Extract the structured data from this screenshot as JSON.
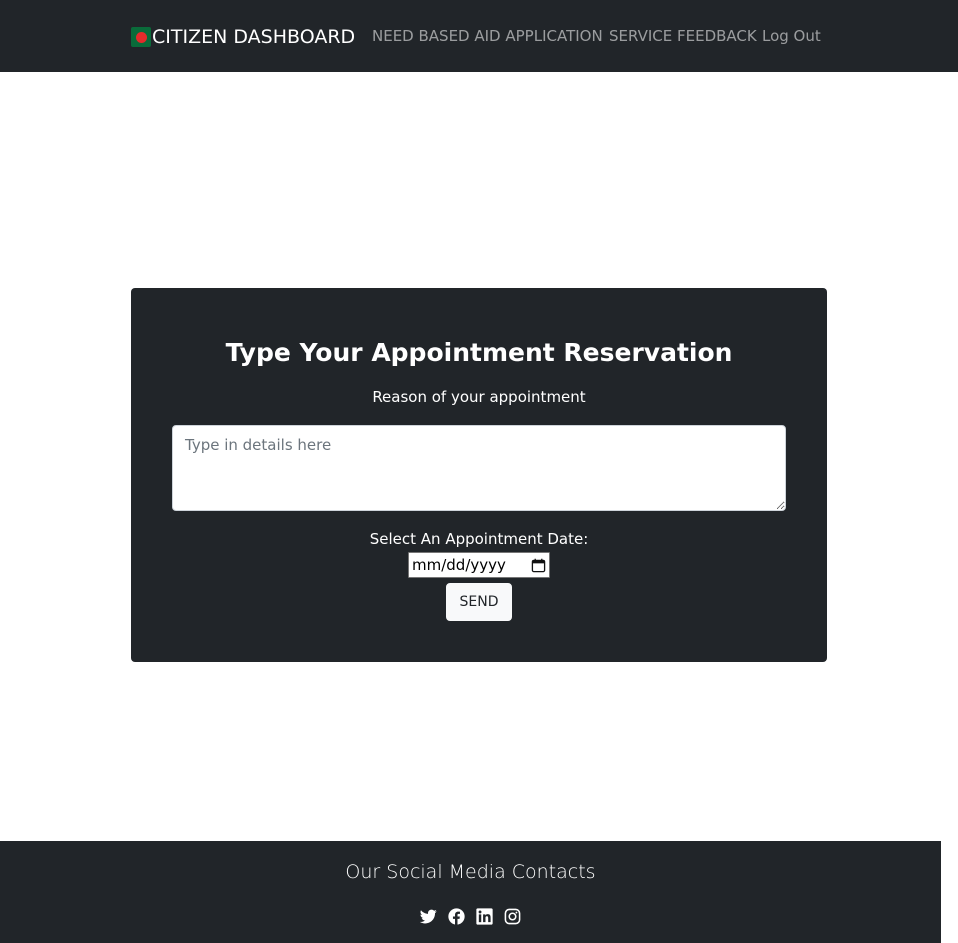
{
  "navbar": {
    "brand_label": "CITIZEN DASHBOARD",
    "brand_icon": "government-logo-icon",
    "links": [
      {
        "label": "NEED BASED AID APPLICATION"
      },
      {
        "label": "SERVICE FEEDBACK"
      },
      {
        "label": "Log Out"
      }
    ]
  },
  "form": {
    "title": "Type Your Appointment Reservation",
    "reason_label": "Reason of your appointment",
    "details_placeholder": "Type in details here",
    "details_value": "",
    "date_label": "Select An Appointment Date:",
    "date_value": "mm/dd/yyyy",
    "date_icon": "calendar-icon",
    "send_label": "SEND"
  },
  "footer": {
    "title": "Our Social Media Contacts",
    "social": [
      {
        "icon": "twitter-icon"
      },
      {
        "icon": "facebook-icon"
      },
      {
        "icon": "linkedin-icon"
      },
      {
        "icon": "instagram-icon"
      }
    ]
  },
  "colors": {
    "dark_background": "#212529",
    "text_light": "#ffffff",
    "nav_link_muted": "#8c8f92",
    "button_light": "#f8f9fa"
  }
}
